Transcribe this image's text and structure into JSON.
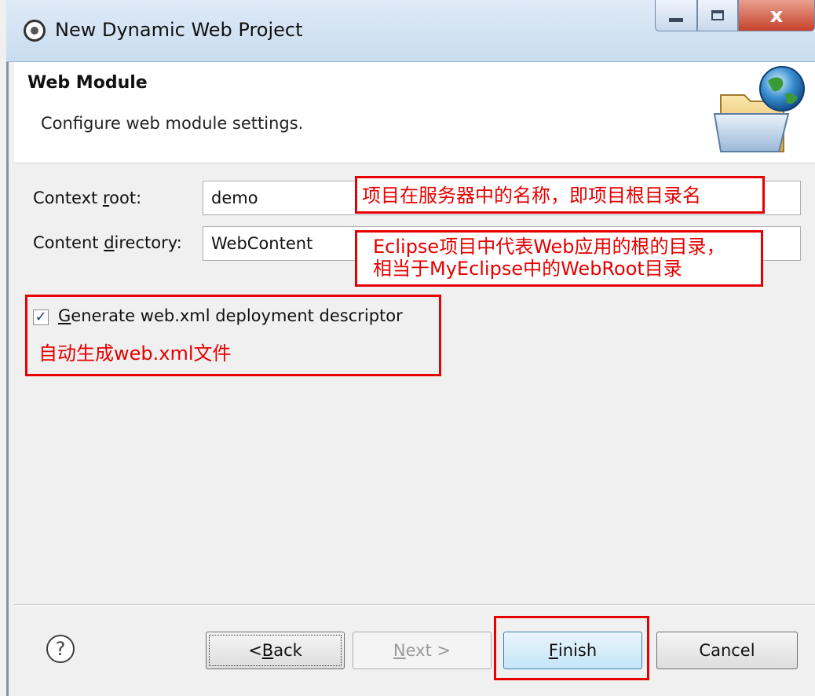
{
  "window": {
    "title": "New Dynamic Web Project",
    "minimize_icon": "minimize-icon",
    "maximize_icon": "maximize-icon",
    "close_glyph": "x"
  },
  "header": {
    "title": "Web Module",
    "subtitle": "Configure web module settings.",
    "icon": "folder-globe-icon"
  },
  "form": {
    "context_root": {
      "label_pre": "Context ",
      "label_mnemonic": "r",
      "label_post": "oot:",
      "value": "demo"
    },
    "content_directory": {
      "label_pre": "Content ",
      "label_mnemonic": "d",
      "label_post": "irectory:",
      "value": "WebContent"
    },
    "generate_descriptor": {
      "checked": true,
      "label_mnemonic": "G",
      "label_post": "enerate web.xml deployment descriptor"
    }
  },
  "annotations": {
    "context_root": "项目在服务器中的名称，即项目根目录名",
    "content_directory_line1": "Eclipse项目中代表Web应用的根的目录，",
    "content_directory_line2": "相当于MyEclipse中的WebRoot目录",
    "generate": "自动生成web.xml文件",
    "color": "#e60000"
  },
  "buttons": {
    "help_glyph": "?",
    "back": {
      "pre": "< ",
      "mnemonic": "B",
      "post": "ack"
    },
    "next": {
      "mnemonic": "N",
      "post": "ext >",
      "enabled": false
    },
    "finish": {
      "mnemonic": "F",
      "post": "inish"
    },
    "cancel": "Cancel"
  }
}
